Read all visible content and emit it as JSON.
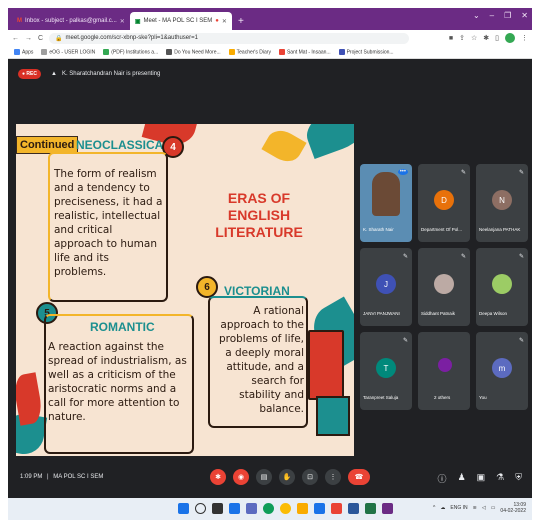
{
  "browser": {
    "tabs": [
      {
        "label": "Inbox - subject - palkas@gmail.c...",
        "active": false
      },
      {
        "label": "Meet - MA POL SC I SEM",
        "active": true
      }
    ],
    "new_tab": "+",
    "window_controls": [
      "⌄",
      "–",
      "❐",
      "✕"
    ],
    "url": "meet.google.com/scr-xbnp-ske?pli=1&authuser=1",
    "bookmarks": [
      "Apps",
      "eOG - USER LOGIN",
      "(PDF) Institutions a...",
      "Do You Need More...",
      "Teacher's Diary",
      "Sant Mat - Insaan...",
      "Project Submission..."
    ]
  },
  "meet": {
    "rec_label": "REC",
    "presenting_text": "K. Sharatchandran Nair is presenting",
    "meeting_time": "1:09 PM",
    "meeting_sep": "|",
    "meeting_name": "MA POL SC I SEM"
  },
  "slide": {
    "continued": "Continued",
    "title_line1": "ERAS OF",
    "title_line2": "ENGLISH LITERATURE",
    "neoclassical": {
      "number": "4",
      "heading": "NEOCLASSICAL",
      "text": "The form of realism and a tendency to preciseness, it had a realistic, intellectual and critical approach to human life and its problems."
    },
    "romantic": {
      "number": "5",
      "heading": "ROMANTIC",
      "text": "A reaction against the spread of industrialism, as well as a criticism of the aristocratic norms and a call for more attention to nature."
    },
    "victorian": {
      "number": "6",
      "heading": "VICTORIAN",
      "text": "A rational approach to the problems of life, a deeply moral attitude, and a search for stability and balance."
    }
  },
  "participants": [
    {
      "name": "K. Sharath Nair",
      "initial": "",
      "color": "#7aa7c7",
      "photo": true
    },
    {
      "name": "Department Of Pol...",
      "initial": "D",
      "color": "#e8710a"
    },
    {
      "name": "Neelanjana PATHAK",
      "initial": "N",
      "color": "#8d6e63"
    },
    {
      "name": "JANVI PANJWANI",
      "initial": "J",
      "color": "#3f51b5"
    },
    {
      "name": "Siddhant Patnaik",
      "initial": "",
      "color": "#bcaaa4",
      "photo": true
    },
    {
      "name": "Deepa Wilson",
      "initial": "",
      "color": "#9ccc65",
      "photo": true
    },
    {
      "name": "Taranpreet Saluja",
      "initial": "T",
      "color": "#00897b"
    },
    {
      "name": "2 others",
      "initial": "",
      "color": "#7b1fa2",
      "photo": true
    },
    {
      "name": "You",
      "initial": "m",
      "color": "#5c6bc0"
    }
  ],
  "taskbar": {
    "lang": "ENG IN",
    "time": "13:09",
    "date": "04-02-2022"
  },
  "colors": {
    "accent_red": "#ea4335",
    "chrome_purple": "#6b2b84",
    "slide_bg": "#f7e4d2"
  }
}
